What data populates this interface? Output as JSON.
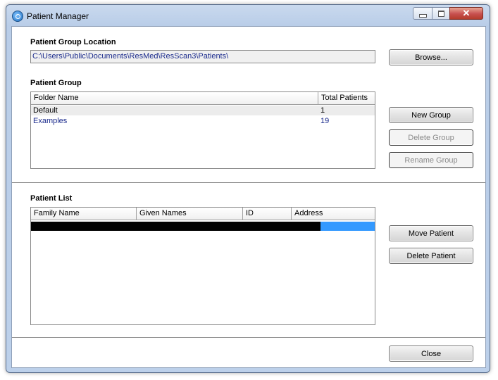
{
  "window": {
    "title": "Patient Manager",
    "controls": {
      "minimize": "minimize-icon",
      "maximize": "maximize-icon",
      "close": "close-icon"
    }
  },
  "location": {
    "label": "Patient Group Location",
    "path": "C:\\Users\\Public\\Documents\\ResMed\\ResScan3\\Patients\\",
    "browse_label": "Browse..."
  },
  "group": {
    "label": "Patient Group",
    "columns": [
      "Folder Name",
      "Total Patients"
    ],
    "rows": [
      {
        "name": "Default",
        "count": "1"
      },
      {
        "name": "Examples",
        "count": "19"
      }
    ],
    "new_label": "New Group",
    "delete_label": "Delete Group",
    "rename_label": "Rename Group"
  },
  "patients": {
    "label": "Patient List",
    "columns": [
      "Family Name",
      "Given Names",
      "ID",
      "Address"
    ],
    "rows": [],
    "move_label": "Move Patient",
    "delete_label": "Delete Patient"
  },
  "footer": {
    "close_label": "Close"
  },
  "colors": {
    "accent": "#1a2a8c",
    "selection": "#3399ff",
    "redacted": "#000000"
  }
}
